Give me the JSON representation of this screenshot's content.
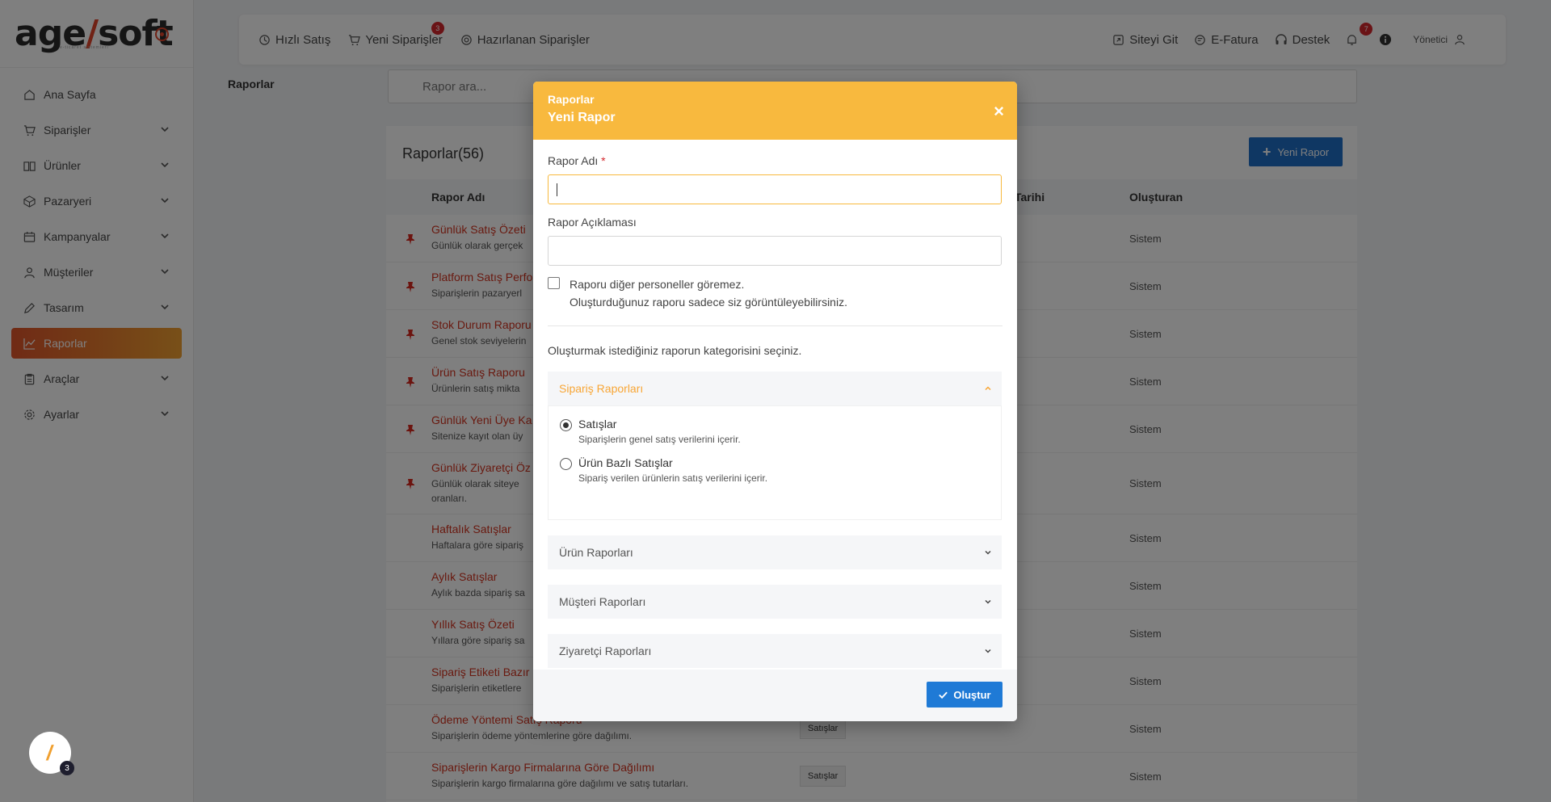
{
  "brand": {
    "logo_main": "age",
    "logo_slash": "/",
    "logo_tail": "soft",
    "logo_sub": "e-ticaret sistemleri",
    "accent": "#f8b93e",
    "primary": "#1f6fc6",
    "danger": "#d4262c"
  },
  "sidebar": {
    "items": [
      {
        "label": "Ana Sayfa",
        "icon": "home-icon",
        "has_children": false,
        "active": false
      },
      {
        "label": "Siparişler",
        "icon": "cart-icon",
        "has_children": true,
        "active": false
      },
      {
        "label": "Ürünler",
        "icon": "book-icon",
        "has_children": true,
        "active": false
      },
      {
        "label": "Pazaryeri",
        "icon": "box-icon",
        "has_children": true,
        "active": false
      },
      {
        "label": "Kampanyalar",
        "icon": "calendar-icon",
        "has_children": true,
        "active": false
      },
      {
        "label": "Müşteriler",
        "icon": "user-icon",
        "has_children": true,
        "active": false
      },
      {
        "label": "Tasarım",
        "icon": "edit-icon",
        "has_children": true,
        "active": false
      },
      {
        "label": "Raporlar",
        "icon": "chart-icon",
        "has_children": false,
        "active": true
      },
      {
        "label": "Araçlar",
        "icon": "clipboard-icon",
        "has_children": true,
        "active": false
      },
      {
        "label": "Ayarlar",
        "icon": "gear-icon",
        "has_children": true,
        "active": false
      }
    ]
  },
  "topbar": {
    "quick_sale": "Hızlı Satış",
    "new_orders": "Yeni Siparişler",
    "new_orders_count": "3",
    "prepared_orders": "Hazırlanan Siparişler",
    "visit_site": "Siteyi Git",
    "e_invoice": "E-Fatura",
    "support": "Destek",
    "notif_count": "7",
    "user": "Yönetici"
  },
  "page": {
    "title": "Raporlar",
    "search_placeholder": "Rapor ara..."
  },
  "reports": {
    "title": "Raporlar(56)",
    "new_button": "Yeni Rapor",
    "columns": {
      "name": "Rapor Adı",
      "date": "Tarihi",
      "creator": "Oluşturan"
    },
    "rows": [
      {
        "name": "Günlük Satış Özeti",
        "desc": "Günlük olarak gerçek",
        "pinned": true,
        "category": "",
        "creator": "Sistem"
      },
      {
        "name": "Platform Satış Perfo",
        "desc": "Siparişlerin pazaryerl",
        "pinned": true,
        "category": "",
        "creator": "Sistem"
      },
      {
        "name": "Stok Durum Raporu",
        "desc": "Genel stok seviyelerin",
        "pinned": true,
        "category": "",
        "creator": "Sistem"
      },
      {
        "name": "Ürün Satış Raporu",
        "desc": "Ürünlerin satış mikta",
        "pinned": true,
        "category": "",
        "creator": "Sistem"
      },
      {
        "name": "Günlük Yeni Üye Ka",
        "desc": "Sitenize kayıt olan üy",
        "pinned": true,
        "category": "",
        "creator": "Sistem"
      },
      {
        "name": "Günlük Ziyaretçi Öz",
        "desc": "Günlük olarak siteye",
        "desc2": "oranları.",
        "pinned": true,
        "category": "",
        "creator": "Sistem"
      },
      {
        "name": "Haftalık Satışlar",
        "desc": "Haftalara göre sipariş",
        "pinned": false,
        "category": "",
        "creator": "Sistem"
      },
      {
        "name": "Aylık Satışlar",
        "desc": "Aylık bazda sipariş sa",
        "pinned": false,
        "category": "",
        "creator": "Sistem"
      },
      {
        "name": "Yıllık Satış Özeti",
        "desc": "Yıllara göre sipariş sa",
        "pinned": false,
        "category": "",
        "creator": "Sistem"
      },
      {
        "name": "Sipariş Etiketi Bazır",
        "desc": "Siparişlerin etiketlere",
        "pinned": false,
        "category": "",
        "creator": "Sistem"
      },
      {
        "name": "Ödeme Yöntemi Satış Raporu",
        "desc": "Siparişlerin ödeme yöntemlerine göre dağılımı.",
        "pinned": false,
        "category": "Satışlar",
        "creator": "Sistem"
      },
      {
        "name": "Siparişlerin Kargo Firmalarına Göre Dağılımı",
        "desc": "Siparişlerin kargo firmalarına göre dağılımı ve satış tutarları.",
        "pinned": false,
        "category": "Satışlar",
        "creator": "Sistem"
      }
    ]
  },
  "modal": {
    "breadcrumb": "Raporlar",
    "title": "Yeni Rapor",
    "name_label": "Rapor Adı",
    "name_required": "*",
    "name_value": "",
    "desc_label": "Rapor Açıklaması",
    "desc_value": "",
    "private_label": "Raporu diğer personeller göremez.",
    "private_hint": "Oluşturduğunuz raporu sadece siz görüntüleyebilirsiniz.",
    "private_checked": false,
    "category_prompt": "Oluşturmak istediğiniz raporun kategorisini seçiniz.",
    "sections": [
      {
        "title": "Sipariş Raporları",
        "open": true,
        "options": [
          {
            "label": "Satışlar",
            "desc": "Siparişlerin genel satış verilerini içerir.",
            "selected": true
          },
          {
            "label": "Ürün Bazlı Satışlar",
            "desc": "Sipariş verilen ürünlerin satış verilerini içerir.",
            "selected": false
          }
        ]
      },
      {
        "title": "Ürün Raporları",
        "open": false
      },
      {
        "title": "Müşteri Raporları",
        "open": false
      },
      {
        "title": "Ziyaretçi Raporları",
        "open": false
      }
    ],
    "submit": "Oluştur"
  },
  "widget": {
    "badge": "3"
  }
}
